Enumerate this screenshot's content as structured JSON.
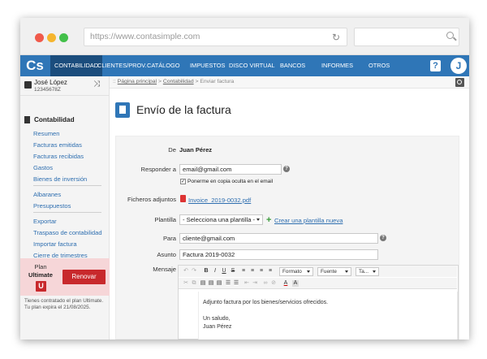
{
  "browser": {
    "url": "https://www.contasimple.com",
    "dots": [
      "#f05a4b",
      "#f5b52e",
      "#43c04a"
    ]
  },
  "nav": {
    "logo": "Cs",
    "items": [
      "CONTABILIDAD",
      "CLIENTES/PROV.",
      "CATÁLOGO",
      "IMPUESTOS",
      "DISCO VIRTUAL",
      "BANCOS",
      "INFORMES",
      "OTROS"
    ],
    "active_index": 0,
    "help": "?",
    "user_initial": "J"
  },
  "sidebar": {
    "user_name": "José López",
    "user_id": "12345678Z",
    "section_title": "Contabilidad",
    "group1": [
      "Resumen",
      "Facturas emitidas",
      "Facturas recibidas",
      "Gastos",
      "Bienes de inversión"
    ],
    "group2": [
      "Albaranes",
      "Presupuestos"
    ],
    "group3": [
      "Exportar",
      "Traspaso de contabilidad",
      "Importar factura",
      "Cierre de trimestres"
    ],
    "plan_label": "Plan",
    "plan_name": "Ultimate",
    "plan_badge": "U",
    "renew_label": "Renovar",
    "plan_info_line1": "Tienes contratado el plan Ultimate.",
    "plan_info_line2": "Tu plan expira el 21/08/2025."
  },
  "breadcrumb": {
    "prefix": "::",
    "home": "Página principal",
    "section": "Contabilidad",
    "current": "> Enviar factura",
    "sep": ">"
  },
  "page": {
    "title": "Envío de la factura"
  },
  "form": {
    "de_label": "De",
    "de_value": "Juan Pérez",
    "reply_label": "Responder a",
    "reply_value": "email@gmail.com",
    "bcc_label": "Ponerme en copia oculta en el email",
    "bcc_checked": "✓",
    "files_label": "Ficheros adjuntos",
    "file_name": "Invoice_2019-0032.pdf",
    "template_label": "Plantilla",
    "template_value": "- Selecciona una plantilla -",
    "create_template": "Crear una plantilla nueva",
    "to_label": "Para",
    "to_value": "cliente@gmail.com",
    "subject_label": "Asunto",
    "subject_value": "Factura 2019-0032",
    "message_label": "Mensaje",
    "help": "?"
  },
  "editor": {
    "format_label": "Formato",
    "font_label": "Fuente",
    "size_label": "Ta...",
    "body_line1": "Adjunto factura por los bienes/servicios ofrecidos.",
    "body_line2": "Un saludo,",
    "body_line3": "Juan Pérez"
  }
}
